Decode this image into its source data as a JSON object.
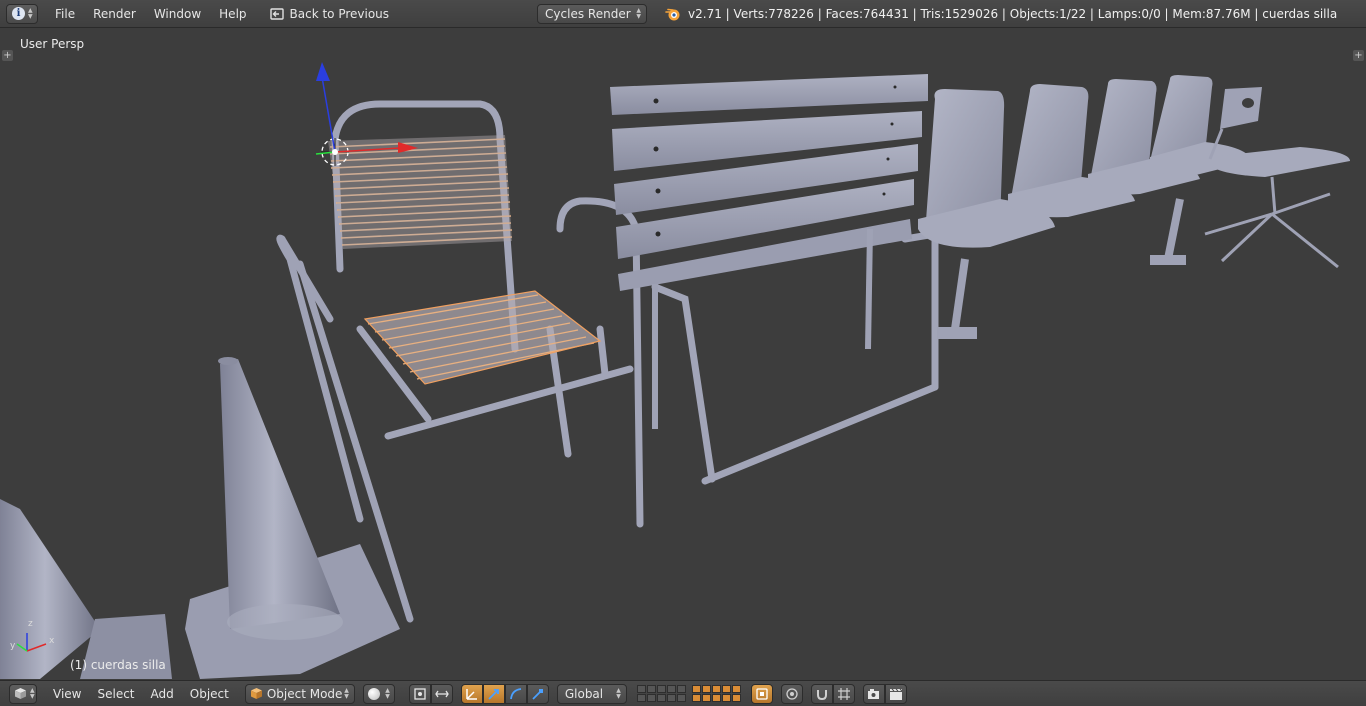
{
  "topbar": {
    "editor_icon": "info-icon",
    "menus": [
      "File",
      "Render",
      "Window",
      "Help"
    ],
    "back_button": "Back to Previous",
    "render_engine": "Cycles Render",
    "stats": "v2.71 | Verts:778226 | Faces:764431 | Tris:1529026 | Objects:1/22 | Lamps:0/0 | Mem:87.76M | cuerdas silla"
  },
  "viewport": {
    "view_label": "User Persp",
    "object_label": "(1) cuerdas silla",
    "axes": {
      "x": "x",
      "y": "y",
      "z": "z"
    }
  },
  "bottombar": {
    "menus": [
      "View",
      "Select",
      "Add",
      "Object"
    ],
    "mode": "Object Mode",
    "orientation": "Global"
  },
  "colors": {
    "header_bg": "#434343",
    "viewport_bg": "#3d3d3d",
    "mesh": "#a0a3b6",
    "selection": "#f0a060",
    "active_button": "#d98c36"
  }
}
